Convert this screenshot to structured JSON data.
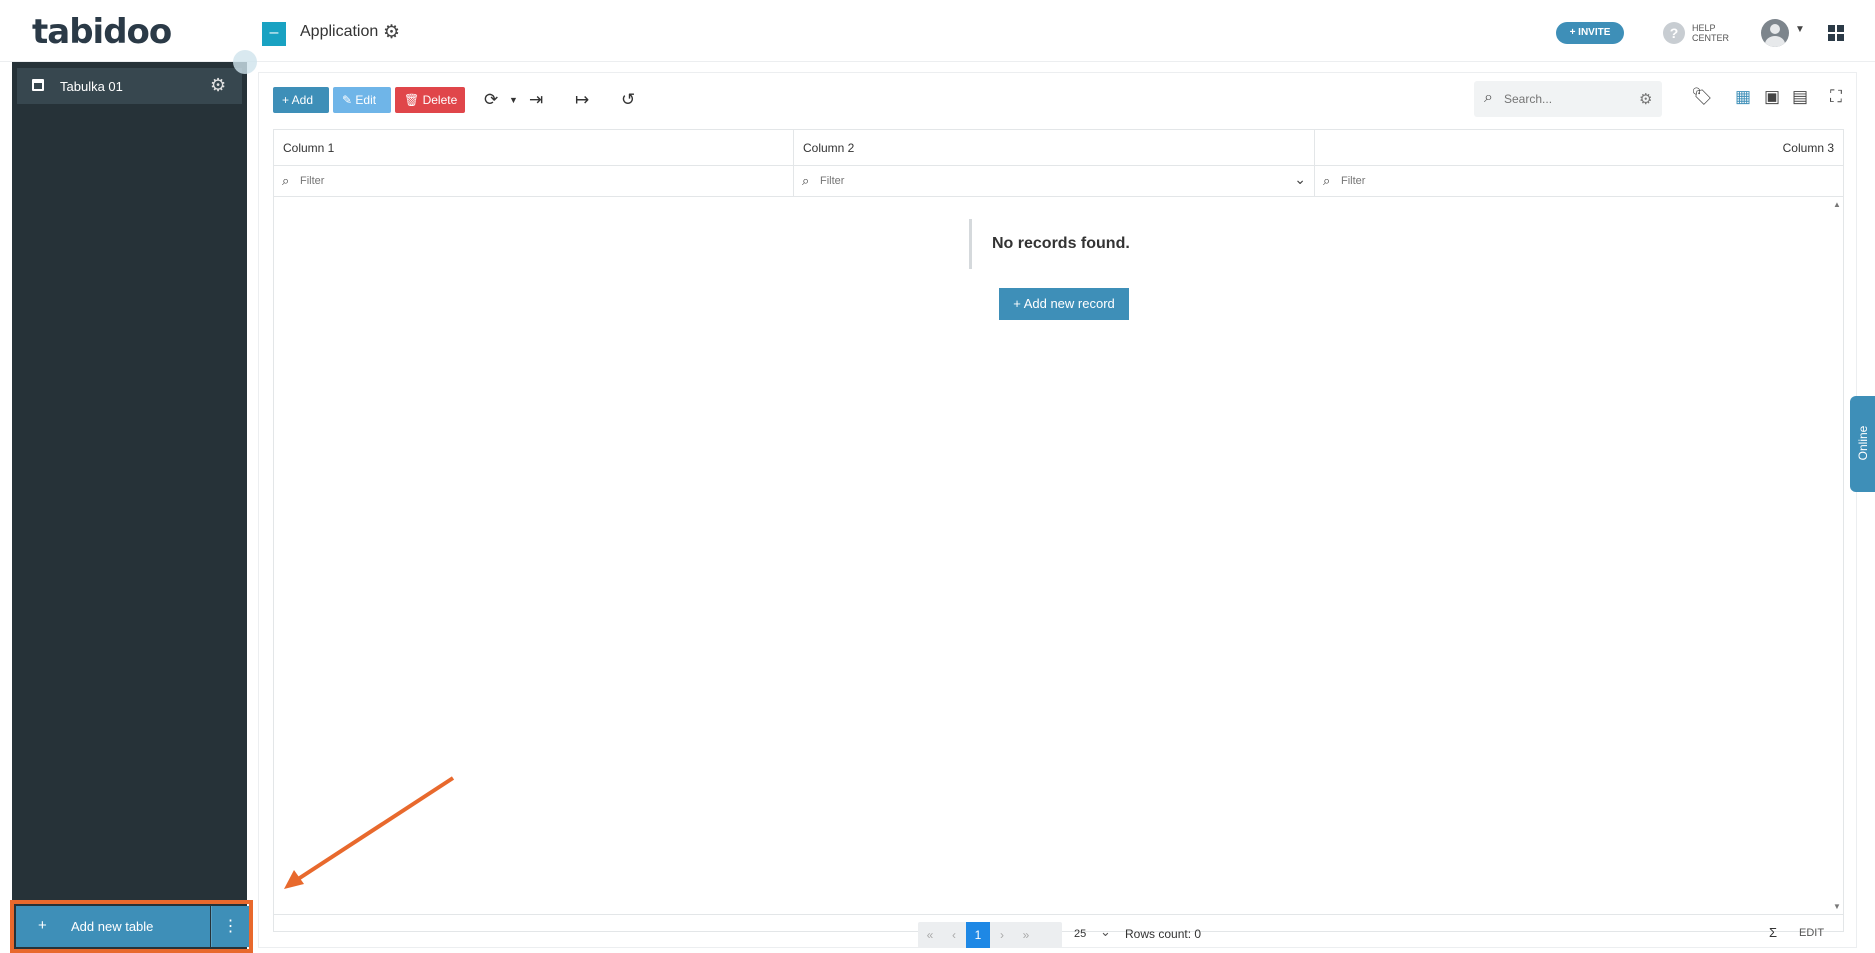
{
  "brand": {
    "logo_text": "tabidoo"
  },
  "header": {
    "toggle_icon": "minus",
    "app_title": "Application",
    "settings_icon": "gear-icon",
    "invite_label": "+ INVITE",
    "help_label_line1": "HELP",
    "help_label_line2": "CENTER",
    "help_icon": "?",
    "apps_icon": "grid-icon"
  },
  "sidebar": {
    "items": [
      {
        "label": "Tabulka 01",
        "icon": "calendar-icon"
      }
    ],
    "add_table_label": "Add new table",
    "add_table_plus": "+",
    "more_icon": "⋮"
  },
  "toolbar": {
    "add_label": "+ Add",
    "edit_label": "✎ Edit",
    "delete_label": "🗑 Delete",
    "search_placeholder": "Search..."
  },
  "table": {
    "columns": [
      "Column 1",
      "Column 2",
      "Column 3"
    ],
    "filter_placeholder": "Filter",
    "empty_message": "No records found.",
    "add_record_label": "+ Add new record"
  },
  "footer": {
    "first": "«",
    "prev": "‹",
    "current_page": "1",
    "next": "›",
    "last": "»",
    "page_size": "25",
    "rows_count": "Rows count: 0",
    "sigma": "Σ",
    "edit_label": "EDIT"
  },
  "online_tab": {
    "label": "Online"
  },
  "colors": {
    "accent": "#3e8fb8",
    "sidebar_bg": "#263238",
    "delete": "#e0464a",
    "highlight": "#e8692d"
  }
}
